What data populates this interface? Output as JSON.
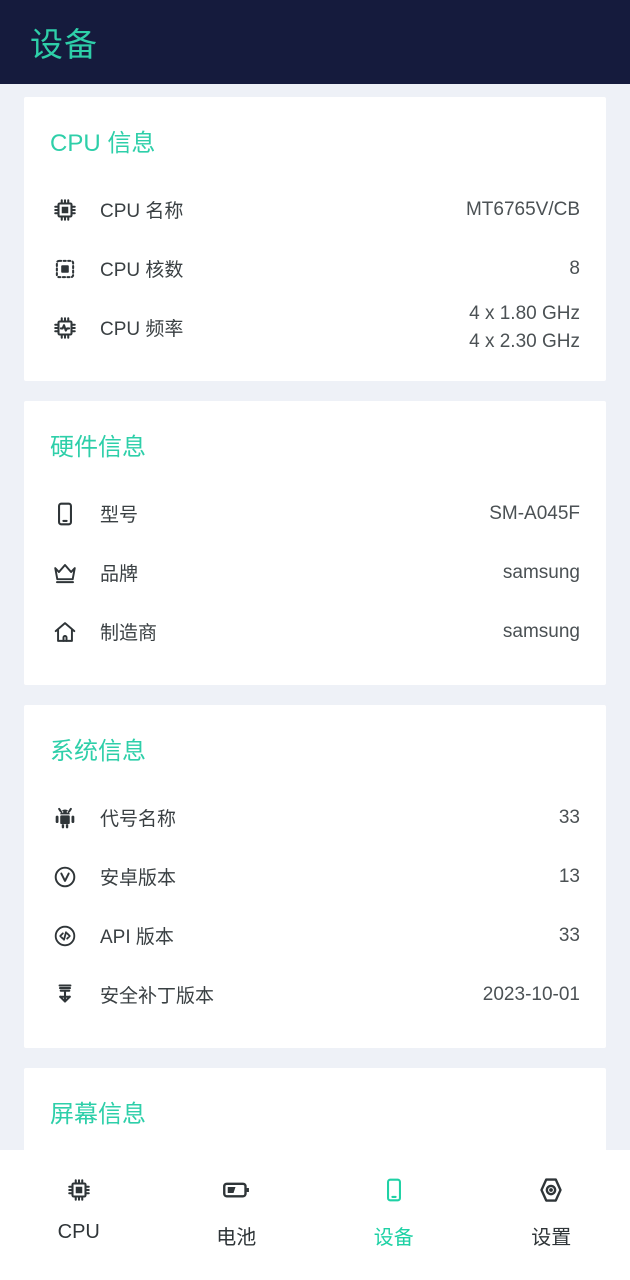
{
  "header": {
    "title": "设备"
  },
  "cards": [
    {
      "title": "CPU 信息",
      "rows": [
        {
          "icon": "cpu-chip-icon",
          "label": "CPU 名称",
          "value": "MT6765V/CB"
        },
        {
          "icon": "cpu-cores-icon",
          "label": "CPU 核数",
          "value": "8"
        },
        {
          "icon": "cpu-frequency-icon",
          "label": "CPU 频率",
          "value": "4 x 1.80 GHz\n4 x 2.30 GHz"
        }
      ]
    },
    {
      "title": "硬件信息",
      "rows": [
        {
          "icon": "phone-icon",
          "label": "型号",
          "value": "SM-A045F"
        },
        {
          "icon": "crown-icon",
          "label": "品牌",
          "value": "samsung"
        },
        {
          "icon": "home-icon",
          "label": "制造商",
          "value": "samsung"
        }
      ]
    },
    {
      "title": "系统信息",
      "rows": [
        {
          "icon": "android-icon",
          "label": "代号名称",
          "value": "33"
        },
        {
          "icon": "version-circle-icon",
          "label": "安卓版本",
          "value": "13"
        },
        {
          "icon": "code-circle-icon",
          "label": "API 版本",
          "value": "33"
        },
        {
          "icon": "security-patch-icon",
          "label": "安全补丁版本",
          "value": "2023-10-01"
        }
      ]
    },
    {
      "title": "屏幕信息",
      "rows": []
    }
  ],
  "tabs": [
    {
      "icon": "cpu-chip-icon",
      "label": "CPU",
      "active": false
    },
    {
      "icon": "battery-icon",
      "label": "电池",
      "active": false
    },
    {
      "icon": "phone-icon",
      "label": "设备",
      "active": true
    },
    {
      "icon": "settings-hex-icon",
      "label": "设置",
      "active": false
    }
  ],
  "colors": {
    "accent": "#2ecfa9",
    "header_bg": "#151b3d",
    "page_bg": "#eef1f7",
    "card_bg": "#ffffff",
    "text": "#3a4043"
  }
}
